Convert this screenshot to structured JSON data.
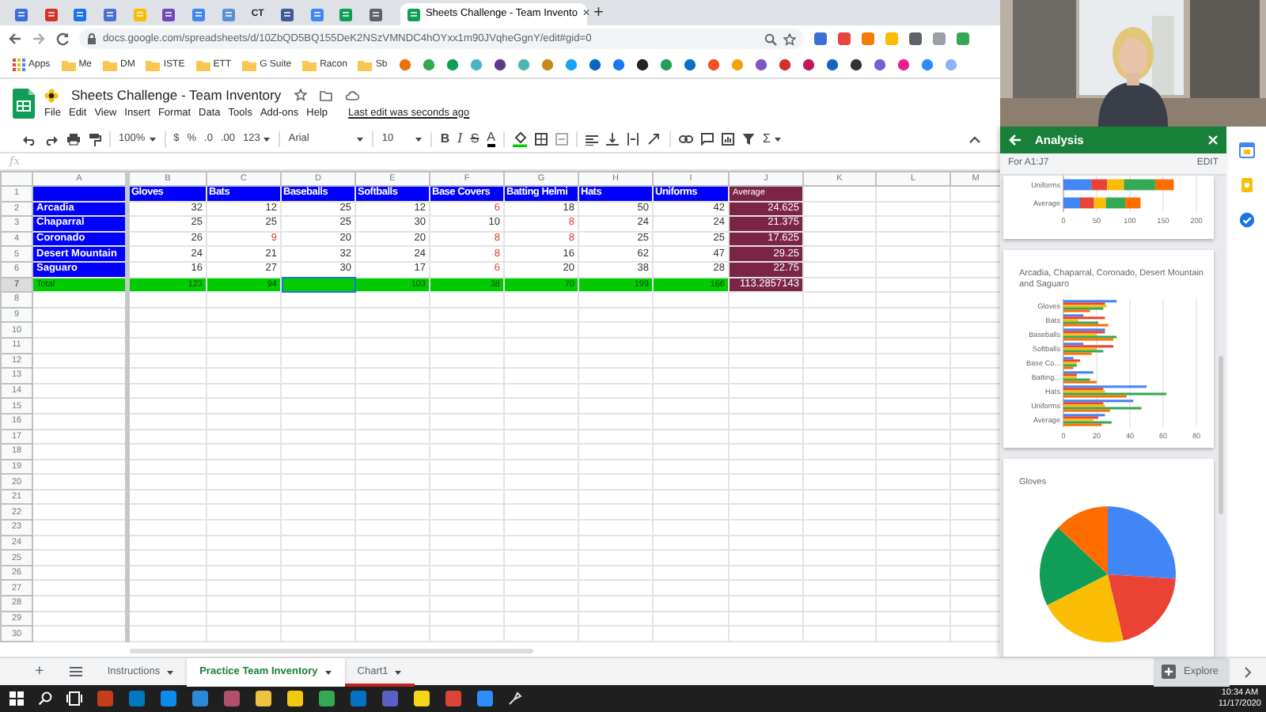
{
  "browser": {
    "tabs": [
      {
        "color": "#3b6fd6",
        "selected": false
      },
      {
        "color": "#d93025",
        "selected": false
      },
      {
        "color": "#1a73e8",
        "selected": false
      },
      {
        "color": "#4a6fd0",
        "selected": false
      },
      {
        "color": "#fbbc04",
        "selected": false
      },
      {
        "color": "#7248b9",
        "selected": false
      },
      {
        "color": "#4285f4",
        "selected": false
      },
      {
        "color": "#5b8fd6",
        "selected": false
      },
      {
        "label": "CT",
        "color": "#202124",
        "selected": false
      },
      {
        "color": "#3d5a99",
        "selected": false
      },
      {
        "color": "#4285f4",
        "selected": false
      },
      {
        "color": "#0f9d58",
        "selected": false
      },
      {
        "color": "#5f6368",
        "selected": false
      },
      {
        "title": "Sheets Challenge - Team Invento",
        "close": "✕",
        "color": "#0f9d58",
        "selected": true
      }
    ],
    "new_tab": "+",
    "url": "docs.google.com/spreadsheets/d/10ZbQD5BQ155DeK2NSzVMNDC4hOYxx1m90JVqheGgnY/edit#gid=0",
    "extensions": [
      {
        "color": "#3b6fd6"
      },
      {
        "color": "#e8453c"
      },
      {
        "color": "#f57c00"
      },
      {
        "color": "#fbbc04"
      },
      {
        "color": "#5f6368"
      },
      {
        "color": "#9aa0a6"
      },
      {
        "color": "#34a853"
      }
    ],
    "bookmarks": [
      {
        "kind": "apps",
        "label": "Apps"
      },
      {
        "kind": "folder",
        "label": "Me"
      },
      {
        "kind": "folder",
        "label": "DM"
      },
      {
        "kind": "folder",
        "label": "ISTE"
      },
      {
        "kind": "folder",
        "label": "ETT"
      },
      {
        "kind": "folder",
        "label": "G Suite"
      },
      {
        "kind": "folder",
        "label": "Racon"
      },
      {
        "kind": "folder",
        "label": "Sb"
      }
    ],
    "bookmark_icons": [
      {
        "color": "#e8710a"
      },
      {
        "color": "#34a853"
      },
      {
        "color": "#0f9d58"
      },
      {
        "color": "#4ab3c8"
      },
      {
        "color": "#5f3a8b"
      },
      {
        "color": "#4db6ac"
      },
      {
        "color": "#c58b19"
      },
      {
        "color": "#1da1f2"
      },
      {
        "color": "#0a66c2"
      },
      {
        "color": "#1877f2"
      },
      {
        "color": "#222222"
      },
      {
        "color": "#25a05c"
      },
      {
        "color": "#0a6fc2"
      },
      {
        "color": "#f25022"
      },
      {
        "color": "#f0a30a"
      },
      {
        "color": "#7e57c2"
      },
      {
        "color": "#d32f2f"
      },
      {
        "color": "#c2185b"
      },
      {
        "color": "#1565c0"
      },
      {
        "color": "#333333"
      },
      {
        "color": "#7b5cd6"
      },
      {
        "color": "#e91e8c"
      },
      {
        "color": "#2d8cff"
      },
      {
        "color": "#8ab4f8"
      }
    ]
  },
  "document": {
    "title": "Sheets Challenge - Team Inventory",
    "menu": [
      "File",
      "Edit",
      "View",
      "Insert",
      "Format",
      "Data",
      "Tools",
      "Add-ons",
      "Help"
    ],
    "last_edit": "Last edit was seconds ago"
  },
  "toolbar": {
    "zoom": "100%",
    "currency": "$",
    "percent": "%",
    "decimal_less": ".0",
    "decimal_more": ".00",
    "number_format": "123",
    "font": "Arial",
    "font_size": "10",
    "bold": "B",
    "italic": "I",
    "strikethrough": "S",
    "text_color": "A",
    "functions": "Σ"
  },
  "formula_bar": {
    "label": "fx"
  },
  "sheet": {
    "column_letters": [
      "A",
      "B",
      "C",
      "D",
      "E",
      "F",
      "G",
      "H",
      "I",
      "J",
      "K",
      "L",
      "M"
    ],
    "row_numbers": [
      "1",
      "2",
      "3",
      "4",
      "5",
      "6",
      "7",
      "8",
      "9",
      "10",
      "11",
      "12",
      "13",
      "14",
      "15",
      "16",
      "17",
      "18",
      "19",
      "20",
      "21",
      "22",
      "23",
      "24",
      "25",
      "26",
      "27",
      "28",
      "29",
      "30"
    ],
    "header": {
      "cells": [
        "Gloves",
        "Bats",
        "Baseballs",
        "Softballs",
        "Base Covers",
        "Batting Helmi",
        "Hats",
        "Uniforms"
      ],
      "average": "Average"
    },
    "rows": [
      {
        "school": "Arcadia",
        "cells": [
          {
            "text": "32",
            "low": false
          },
          {
            "text": "12",
            "low": false
          },
          {
            "text": "25",
            "low": false
          },
          {
            "text": "12",
            "low": false
          },
          {
            "text": "6",
            "low": true
          },
          {
            "text": "18",
            "low": false
          },
          {
            "text": "50",
            "low": false
          },
          {
            "text": "42",
            "low": false
          }
        ],
        "average": "24.625"
      },
      {
        "school": "Chaparral",
        "cells": [
          {
            "text": "25",
            "low": false
          },
          {
            "text": "25",
            "low": false
          },
          {
            "text": "25",
            "low": false
          },
          {
            "text": "30",
            "low": false
          },
          {
            "text": "10",
            "low": false
          },
          {
            "text": "8",
            "low": true
          },
          {
            "text": "24",
            "low": false
          },
          {
            "text": "24",
            "low": false
          }
        ],
        "average": "21.375"
      },
      {
        "school": "Coronado",
        "cells": [
          {
            "text": "26",
            "low": false
          },
          {
            "text": "9",
            "low": true
          },
          {
            "text": "20",
            "low": false
          },
          {
            "text": "20",
            "low": false
          },
          {
            "text": "8",
            "low": true
          },
          {
            "text": "8",
            "low": true
          },
          {
            "text": "25",
            "low": false
          },
          {
            "text": "25",
            "low": false
          }
        ],
        "average": "17.625"
      },
      {
        "school": "Desert Mountain",
        "cells": [
          {
            "text": "24",
            "low": false
          },
          {
            "text": "21",
            "low": false
          },
          {
            "text": "32",
            "low": false
          },
          {
            "text": "24",
            "low": false
          },
          {
            "text": "8",
            "low": true
          },
          {
            "text": "16",
            "low": false
          },
          {
            "text": "62",
            "low": false
          },
          {
            "text": "47",
            "low": false
          }
        ],
        "average": "29.25"
      },
      {
        "school": "Saguaro",
        "cells": [
          {
            "text": "16",
            "low": false
          },
          {
            "text": "27",
            "low": false
          },
          {
            "text": "30",
            "low": false
          },
          {
            "text": "17",
            "low": false
          },
          {
            "text": "6",
            "low": true
          },
          {
            "text": "20",
            "low": false
          },
          {
            "text": "38",
            "low": false
          },
          {
            "text": "28",
            "low": false
          }
        ],
        "average": "22.75"
      }
    ],
    "total": {
      "label": "Total",
      "cells": [
        {
          "text": "123",
          "selected": false
        },
        {
          "text": "94",
          "selected": false
        },
        {
          "selected": true
        },
        {
          "text": "103",
          "selected": false
        },
        {
          "text": "38",
          "selected": false
        },
        {
          "text": "70",
          "selected": false
        },
        {
          "text": "199",
          "selected": false
        },
        {
          "text": "166",
          "selected": false
        }
      ],
      "average": "113.2857143"
    }
  },
  "analysis": {
    "title": "Analysis",
    "range": "For A1:J7",
    "edit": "EDIT",
    "cards": [
      {
        "chart_data": {
          "type": "bar",
          "orientation": "horizontal",
          "stacked": true,
          "grid": true,
          "categories": [
            "Uniforms",
            "Average"
          ],
          "xlim": [
            0,
            200
          ],
          "xticks": [
            0,
            50,
            100,
            150,
            200
          ],
          "series": [
            {
              "color": "#4285f4",
              "values": [
                42,
                25
              ]
            },
            {
              "color": "#ea4335",
              "values": [
                24,
                21
              ]
            },
            {
              "color": "#fbbc04",
              "values": [
                25,
                18
              ]
            },
            {
              "color": "#34a853",
              "values": [
                47,
                29
              ]
            },
            {
              "color": "#ff6d01",
              "values": [
                28,
                23
              ]
            }
          ]
        }
      },
      {
        "chart_data": {
          "type": "bar",
          "orientation": "horizontal",
          "stacked": false,
          "grid": true,
          "title": "Arcadia, Chaparral, Coronado, Desert Mountain and Saguaro",
          "categories": [
            "Gloves",
            "Bats",
            "Baseballs",
            "Softballs",
            "Base Co...",
            "Batting...",
            "Hats",
            "Uniforms",
            "Average"
          ],
          "xlim": [
            0,
            80
          ],
          "xticks": [
            0,
            20,
            40,
            60,
            80
          ],
          "series": [
            {
              "color": "#4285f4",
              "values": [
                32,
                12,
                25,
                12,
                6,
                18,
                50,
                42,
                25
              ]
            },
            {
              "color": "#ea4335",
              "values": [
                25,
                25,
                25,
                30,
                10,
                8,
                24,
                24,
                21
              ]
            },
            {
              "color": "#fbbc04",
              "values": [
                26,
                9,
                20,
                20,
                8,
                8,
                25,
                25,
                18
              ]
            },
            {
              "color": "#34a853",
              "values": [
                24,
                21,
                32,
                24,
                8,
                16,
                62,
                47,
                29
              ]
            },
            {
              "color": "#ff6d01",
              "values": [
                16,
                27,
                30,
                17,
                6,
                20,
                38,
                28,
                23
              ]
            }
          ]
        }
      },
      {
        "chart_data": {
          "type": "pie",
          "title": "Gloves",
          "values": [
            26,
            20.3,
            21.2,
            19.5,
            13
          ],
          "colors": [
            "#4285f4",
            "#ea4335",
            "#fbbc04",
            "#0f9d58",
            "#ff6d01"
          ]
        }
      }
    ]
  },
  "sheet_tabs": {
    "add": "+",
    "tabs": [
      {
        "label": "Instructions",
        "selected": false
      },
      {
        "label": "Practice Team Inventory",
        "selected": true
      },
      {
        "label": "Chart1",
        "selected": false,
        "color": "#c5221f"
      }
    ],
    "explore": "Explore"
  },
  "taskbar": {
    "apps": [
      {
        "color": "#c43e1c"
      },
      {
        "color": "#0079bf"
      },
      {
        "color": "#0c8ce9"
      },
      {
        "color": "#2b88d8"
      },
      {
        "color": "#b0506a"
      },
      {
        "color": "#f0c040"
      },
      {
        "color": "#f2c811"
      },
      {
        "color": "#34a853"
      },
      {
        "color": "#0072c6"
      },
      {
        "color": "#5b5fc7"
      },
      {
        "color": "#f7d417"
      },
      {
        "color": "#db4437"
      },
      {
        "color": "#2d8cff"
      }
    ],
    "time": "10:34 AM",
    "date": "11/17/2020"
  }
}
